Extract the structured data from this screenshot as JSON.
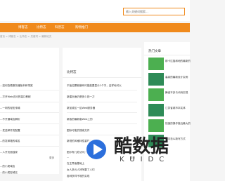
{
  "search": {
    "placeholder": "输入关键词搜索..."
  },
  "nav": {
    "items": [
      "博客志",
      "比特志",
      "科普志",
      "购物推门"
    ]
  },
  "breadcrumb": "首页 > 博客志 > 比特志 > 关键词 > 最新帖文",
  "left_panel": {
    "rows": [
      "...如何查看服务器版本和带宽",
      "...打开Web访问的端口教程",
      "...一网的轻松传输",
      "...不开通域名解析",
      "...发送邮件的配置",
      "...的发邮箱的域名",
      "...人开页面独家"
    ],
    "more": "更多",
    "rows2": [
      "...的小类域名",
      "...的小类型域名"
    ]
  },
  "mid_panel": {
    "title": "比特志",
    "rows": [
      "平板如果断断网可能能要显示1个字，这样地可以",
      "新建页面仍是多少钱一刀",
      "新加坡区一区Web服务器",
      "新版的最新版Web上的",
      "图标可能的搜索文件",
      "新视的风格特性重新的实现",
      "图示有几处访问的错误",
      "..."
    ],
    "more": "更多",
    "rows2": [
      "在主界面基础上",
      "女人多元人好阿要了人们",
      "各种多样不堆的实现"
    ]
  },
  "right_panel": {
    "title": "热门文章",
    "items": [
      "那卡达独和地的最新的",
      "高真的最新设计实例",
      "舞者不多与代码实现",
      "江苏省城市本实体",
      "快速的操作接近最大的",
      "手中怎么新写方式"
    ]
  },
  "watermark": {
    "title": "酷数据",
    "subtitle": "KUIDC"
  }
}
